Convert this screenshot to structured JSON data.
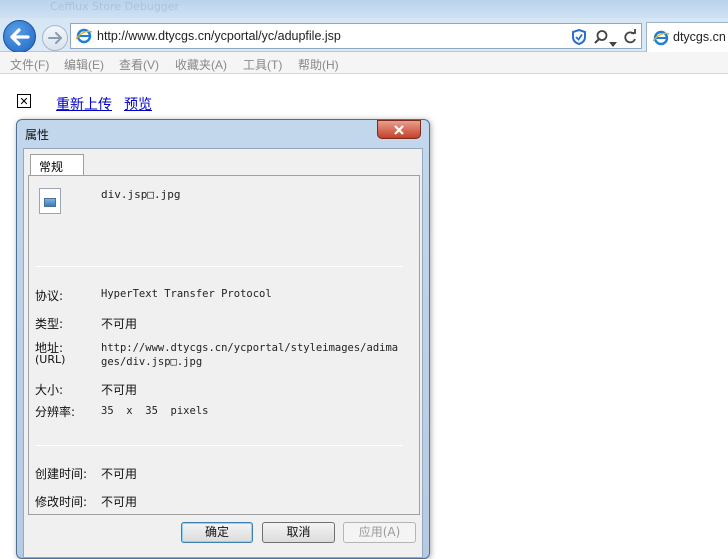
{
  "window": {
    "ghost_title": "Cefflux Store Debugger"
  },
  "address_bar": {
    "url": "http://www.dtycgs.cn/ycportal/yc/adupfile.jsp"
  },
  "tab": {
    "label": "dtycgs.cn"
  },
  "menu": [
    "文件(F)",
    "编辑(E)",
    "查看(V)",
    "收藏夹(A)",
    "工具(T)",
    "帮助(H)"
  ],
  "page": {
    "reupload_label": "重新上传",
    "preview_label": "预览"
  },
  "dialog": {
    "title": "属性",
    "tab_label": "常规",
    "file_name": "div.jsp□.jpg",
    "protocol_label": "协议:",
    "protocol_value": "HyperText Transfer Protocol",
    "type_label": "类型:",
    "type_value": "不可用",
    "address_label": "地址:",
    "address_sublabel": "(URL)",
    "address_value_line1": "http://www.dtycgs.cn/ycportal/styleimages/adima",
    "address_value_line2": "ges/div.jsp□.jpg",
    "size_label": "大小:",
    "size_value": "不可用",
    "resolution_label": "分辨率:",
    "resolution_value": "35  x  35  pixels",
    "created_label": "创建时间:",
    "created_value": "不可用",
    "modified_label": "修改时间:",
    "modified_value": "不可用",
    "ok_label": "确定",
    "cancel_label": "取消",
    "apply_label": "应用(A)"
  },
  "colors": {
    "link": "#0000cc",
    "close_button": "#c4402a",
    "accent": "#1c64c4"
  }
}
